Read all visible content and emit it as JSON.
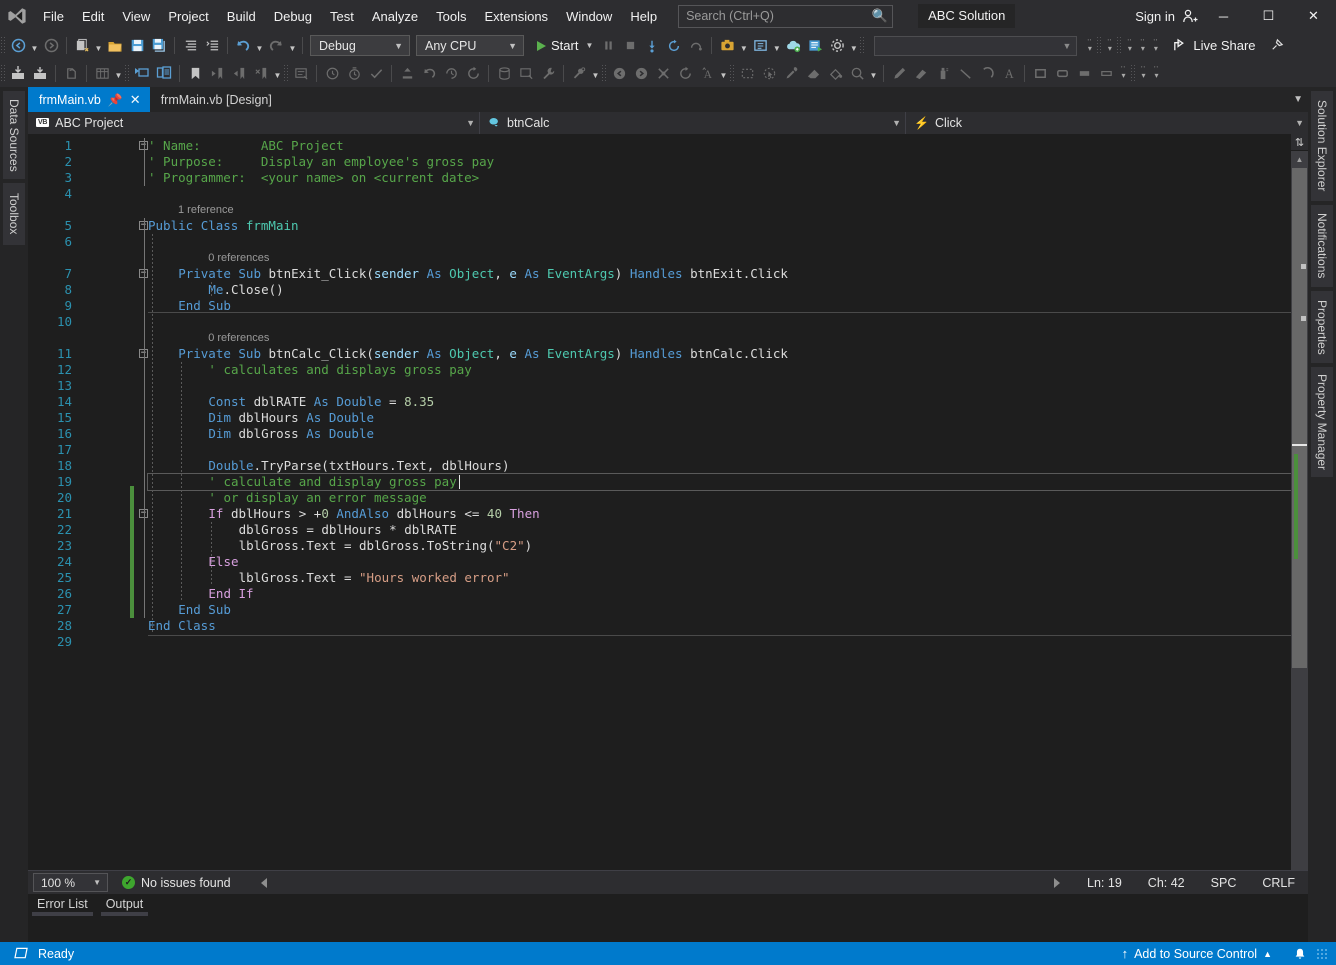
{
  "titlebar": {
    "app_icon": "visual-studio-logo",
    "menus": [
      "File",
      "Edit",
      "View",
      "Project",
      "Build",
      "Debug",
      "Test",
      "Analyze",
      "Tools",
      "Extensions",
      "Window",
      "Help"
    ],
    "search_placeholder": "Search (Ctrl+Q)",
    "search_value": "",
    "search_icon": "search-icon",
    "solution_name": "ABC Solution",
    "signin_label": "Sign in",
    "signin_icon": "account-add-icon",
    "minimize": "─",
    "maximize": "☐",
    "close": "✕"
  },
  "toolbar_main": {
    "back_icon": "navigate-back-icon",
    "forward_icon": "navigate-forward-icon",
    "new_project_icon": "new-project-icon",
    "open_file_icon": "open-file-icon",
    "save_icon": "save-icon",
    "save_all_icon": "save-all-icon",
    "comment_icon": "comment-lines-icon",
    "uncomment_icon": "uncomment-lines-icon",
    "undo_icon": "undo-icon",
    "redo_icon": "redo-icon",
    "config_value": "Debug",
    "platform_value": "Any CPU",
    "start_label": "Start",
    "pause_icon": "pause-icon",
    "stop_icon": "stop-icon",
    "step_into_icon": "step-into-icon",
    "restart_icon": "restart-icon",
    "hot_reload_icon": "hot-reload-icon",
    "screenshot_icon": "screenshot-icon",
    "live_visual_tree_icon": "live-visual-tree-icon",
    "cloud_icon": "cloud-icon",
    "run_to_icon": "run-to-icon",
    "settings_icon": "gear-icon",
    "find_combo_value": "",
    "live_share_label": "Live Share",
    "live_share_icon": "live-share-icon",
    "pin_window_icon": "pin-window-icon"
  },
  "toolbar_secondary": {
    "icons": [
      "import-data-icon",
      "export-data-icon",
      "new-query-icon",
      "data-grid-icon",
      "rename-icon",
      "copy-block-icon",
      "bookmark-icon",
      "prev-bookmark-icon",
      "next-bookmark-icon",
      "clear-bookmark-icon",
      "refresh-grid-icon",
      "add-watch-icon",
      "add-timer-icon",
      "check-icon",
      "deploy-icon",
      "undo2-icon",
      "history-icon",
      "refresh-icon",
      "database-icon",
      "preview-icon",
      "wrench-icon",
      "tool-options-icon",
      "back-circle-icon",
      "forward-circle-icon",
      "delete-x-icon",
      "reload-icon",
      "format-text-icon",
      "select-rect-icon",
      "pointer-icon",
      "circle-select-icon",
      "eyedropper-icon",
      "eraser-icon",
      "fill-icon",
      "magnifier-icon",
      "pencil-icon",
      "brush-icon",
      "spray-icon",
      "line-icon",
      "curve-icon",
      "text-icon",
      "rectangle-icon",
      "rounded-rect-icon",
      "filled-rect-icon",
      "outline-rect-icon"
    ]
  },
  "dock_left": {
    "tabs": [
      "Data Sources",
      "Toolbox"
    ]
  },
  "dock_right": {
    "tabs": [
      "Solution Explorer",
      "Notifications",
      "Properties",
      "Property Manager"
    ]
  },
  "editor": {
    "tabs": [
      {
        "label": "frmMain.vb",
        "active": true,
        "pin_icon": "pin-icon",
        "close_icon": "close-icon"
      },
      {
        "label": "frmMain.vb [Design]",
        "active": false
      }
    ],
    "navbar": {
      "project_icon": "vb-project-icon",
      "project_badge": "VB",
      "project": "ABC Project",
      "member_icon": "control-object-icon",
      "member": "btnCalc",
      "event_icon": "event-bolt-icon",
      "event": "Click"
    },
    "lines": [
      {
        "n": 1,
        "indent": 0,
        "tokens": [
          {
            "t": "' Name:        ABC Project",
            "c": "c-cmt"
          }
        ]
      },
      {
        "n": 2,
        "indent": 0,
        "tokens": [
          {
            "t": "' Purpose:     Display an employee's gross pay",
            "c": "c-cmt"
          }
        ]
      },
      {
        "n": 3,
        "indent": 0,
        "tokens": [
          {
            "t": "' Programmer:  <your name> on <current date>",
            "c": "c-cmt"
          }
        ]
      },
      {
        "n": 4,
        "indent": 0,
        "tokens": []
      },
      {
        "n": 5,
        "indent": 0,
        "tokens": [
          {
            "t": "Public",
            "c": "c-kw"
          },
          {
            "t": " ",
            "c": "c-plain"
          },
          {
            "t": "Class",
            "c": "c-kw"
          },
          {
            "t": " ",
            "c": "c-plain"
          },
          {
            "t": "frmMain",
            "c": "c-type"
          }
        ]
      },
      {
        "n": 6,
        "indent": 0,
        "tokens": []
      },
      {
        "n": 7,
        "indent": 1,
        "tokens": [
          {
            "t": "Private",
            "c": "c-kw"
          },
          {
            "t": " ",
            "c": "c-plain"
          },
          {
            "t": "Sub",
            "c": "c-kw"
          },
          {
            "t": " ",
            "c": "c-plain"
          },
          {
            "t": "btnExit_Click",
            "c": "c-plain"
          },
          {
            "t": "(",
            "c": "c-plain"
          },
          {
            "t": "sender",
            "c": "c-mod"
          },
          {
            "t": " ",
            "c": "c-plain"
          },
          {
            "t": "As",
            "c": "c-kw"
          },
          {
            "t": " ",
            "c": "c-plain"
          },
          {
            "t": "Object",
            "c": "c-type"
          },
          {
            "t": ", ",
            "c": "c-plain"
          },
          {
            "t": "e",
            "c": "c-mod"
          },
          {
            "t": " ",
            "c": "c-plain"
          },
          {
            "t": "As",
            "c": "c-kw"
          },
          {
            "t": " ",
            "c": "c-plain"
          },
          {
            "t": "EventArgs",
            "c": "c-type"
          },
          {
            "t": ") ",
            "c": "c-plain"
          },
          {
            "t": "Handles",
            "c": "c-kw"
          },
          {
            "t": " ",
            "c": "c-plain"
          },
          {
            "t": "btnExit.Click",
            "c": "c-plain"
          }
        ]
      },
      {
        "n": 8,
        "indent": 2,
        "tokens": [
          {
            "t": "Me",
            "c": "c-kw"
          },
          {
            "t": ".",
            "c": "c-plain"
          },
          {
            "t": "Close",
            "c": "c-plain"
          },
          {
            "t": "()",
            "c": "c-plain"
          }
        ]
      },
      {
        "n": 9,
        "indent": 1,
        "tokens": [
          {
            "t": "End",
            "c": "c-kw"
          },
          {
            "t": " ",
            "c": "c-plain"
          },
          {
            "t": "Sub",
            "c": "c-kw"
          }
        ]
      },
      {
        "n": 10,
        "indent": 0,
        "tokens": []
      },
      {
        "n": 11,
        "indent": 1,
        "tokens": [
          {
            "t": "Private",
            "c": "c-kw"
          },
          {
            "t": " ",
            "c": "c-plain"
          },
          {
            "t": "Sub",
            "c": "c-kw"
          },
          {
            "t": " ",
            "c": "c-plain"
          },
          {
            "t": "btnCalc_Click",
            "c": "c-plain"
          },
          {
            "t": "(",
            "c": "c-plain"
          },
          {
            "t": "sender",
            "c": "c-mod"
          },
          {
            "t": " ",
            "c": "c-plain"
          },
          {
            "t": "As",
            "c": "c-kw"
          },
          {
            "t": " ",
            "c": "c-plain"
          },
          {
            "t": "Object",
            "c": "c-type"
          },
          {
            "t": ", ",
            "c": "c-plain"
          },
          {
            "t": "e",
            "c": "c-mod"
          },
          {
            "t": " ",
            "c": "c-plain"
          },
          {
            "t": "As",
            "c": "c-kw"
          },
          {
            "t": " ",
            "c": "c-plain"
          },
          {
            "t": "EventArgs",
            "c": "c-type"
          },
          {
            "t": ") ",
            "c": "c-plain"
          },
          {
            "t": "Handles",
            "c": "c-kw"
          },
          {
            "t": " ",
            "c": "c-plain"
          },
          {
            "t": "btnCalc.Click",
            "c": "c-plain"
          }
        ]
      },
      {
        "n": 12,
        "indent": 2,
        "tokens": [
          {
            "t": "' calculates and displays gross pay",
            "c": "c-cmt"
          }
        ]
      },
      {
        "n": 13,
        "indent": 0,
        "tokens": []
      },
      {
        "n": 14,
        "indent": 2,
        "tokens": [
          {
            "t": "Const",
            "c": "c-kw"
          },
          {
            "t": " ",
            "c": "c-plain"
          },
          {
            "t": "dblRATE",
            "c": "c-plain"
          },
          {
            "t": " ",
            "c": "c-plain"
          },
          {
            "t": "As",
            "c": "c-kw"
          },
          {
            "t": " ",
            "c": "c-plain"
          },
          {
            "t": "Double",
            "c": "c-kw"
          },
          {
            "t": " = ",
            "c": "c-plain"
          },
          {
            "t": "8.35",
            "c": "c-num"
          }
        ]
      },
      {
        "n": 15,
        "indent": 2,
        "tokens": [
          {
            "t": "Dim",
            "c": "c-kw"
          },
          {
            "t": " ",
            "c": "c-plain"
          },
          {
            "t": "dblHours",
            "c": "c-plain"
          },
          {
            "t": " ",
            "c": "c-plain"
          },
          {
            "t": "As",
            "c": "c-kw"
          },
          {
            "t": " ",
            "c": "c-plain"
          },
          {
            "t": "Double",
            "c": "c-kw"
          }
        ]
      },
      {
        "n": 16,
        "indent": 2,
        "tokens": [
          {
            "t": "Dim",
            "c": "c-kw"
          },
          {
            "t": " ",
            "c": "c-plain"
          },
          {
            "t": "dblGross",
            "c": "c-plain"
          },
          {
            "t": " ",
            "c": "c-plain"
          },
          {
            "t": "As",
            "c": "c-kw"
          },
          {
            "t": " ",
            "c": "c-plain"
          },
          {
            "t": "Double",
            "c": "c-kw"
          }
        ]
      },
      {
        "n": 17,
        "indent": 0,
        "tokens": []
      },
      {
        "n": 18,
        "indent": 2,
        "tokens": [
          {
            "t": "Double",
            "c": "c-kw"
          },
          {
            "t": ".",
            "c": "c-plain"
          },
          {
            "t": "TryParse",
            "c": "c-plain"
          },
          {
            "t": "(",
            "c": "c-plain"
          },
          {
            "t": "txtHours",
            "c": "c-plain"
          },
          {
            "t": ".",
            "c": "c-plain"
          },
          {
            "t": "Text",
            "c": "c-plain"
          },
          {
            "t": ", ",
            "c": "c-plain"
          },
          {
            "t": "dblHours",
            "c": "c-plain"
          },
          {
            "t": ")",
            "c": "c-plain"
          }
        ]
      },
      {
        "n": 19,
        "indent": 2,
        "tokens": [
          {
            "t": "' calculate and display gross pay",
            "c": "c-cmt"
          }
        ],
        "current": true
      },
      {
        "n": 20,
        "indent": 2,
        "tokens": [
          {
            "t": "' or display an error message",
            "c": "c-cmt"
          }
        ]
      },
      {
        "n": 21,
        "indent": 2,
        "tokens": [
          {
            "t": "If",
            "c": "c-kw2"
          },
          {
            "t": " ",
            "c": "c-plain"
          },
          {
            "t": "dblHours",
            "c": "c-plain"
          },
          {
            "t": " > +",
            "c": "c-plain"
          },
          {
            "t": "0",
            "c": "c-num"
          },
          {
            "t": " ",
            "c": "c-plain"
          },
          {
            "t": "AndAlso",
            "c": "c-kw"
          },
          {
            "t": " ",
            "c": "c-plain"
          },
          {
            "t": "dblHours",
            "c": "c-plain"
          },
          {
            "t": " <= ",
            "c": "c-plain"
          },
          {
            "t": "40",
            "c": "c-num"
          },
          {
            "t": " ",
            "c": "c-plain"
          },
          {
            "t": "Then",
            "c": "c-kw2"
          }
        ]
      },
      {
        "n": 22,
        "indent": 3,
        "tokens": [
          {
            "t": "dblGross",
            "c": "c-plain"
          },
          {
            "t": " = ",
            "c": "c-plain"
          },
          {
            "t": "dblHours",
            "c": "c-plain"
          },
          {
            "t": " * ",
            "c": "c-plain"
          },
          {
            "t": "dblRATE",
            "c": "c-plain"
          }
        ]
      },
      {
        "n": 23,
        "indent": 3,
        "tokens": [
          {
            "t": "lblGross",
            "c": "c-plain"
          },
          {
            "t": ".",
            "c": "c-plain"
          },
          {
            "t": "Text",
            "c": "c-plain"
          },
          {
            "t": " = ",
            "c": "c-plain"
          },
          {
            "t": "dblGross",
            "c": "c-plain"
          },
          {
            "t": ".",
            "c": "c-plain"
          },
          {
            "t": "ToString",
            "c": "c-plain"
          },
          {
            "t": "(",
            "c": "c-plain"
          },
          {
            "t": "\"C2\"",
            "c": "c-str"
          },
          {
            "t": ")",
            "c": "c-plain"
          }
        ]
      },
      {
        "n": 24,
        "indent": 2,
        "tokens": [
          {
            "t": "Else",
            "c": "c-kw2"
          }
        ]
      },
      {
        "n": 25,
        "indent": 3,
        "tokens": [
          {
            "t": "lblGross",
            "c": "c-plain"
          },
          {
            "t": ".",
            "c": "c-plain"
          },
          {
            "t": "Text",
            "c": "c-plain"
          },
          {
            "t": " = ",
            "c": "c-plain"
          },
          {
            "t": "\"Hours worked error\"",
            "c": "c-str"
          }
        ]
      },
      {
        "n": 26,
        "indent": 2,
        "tokens": [
          {
            "t": "End",
            "c": "c-kw2"
          },
          {
            "t": " ",
            "c": "c-plain"
          },
          {
            "t": "If",
            "c": "c-kw2"
          }
        ]
      },
      {
        "n": 27,
        "indent": 1,
        "tokens": [
          {
            "t": "End",
            "c": "c-kw"
          },
          {
            "t": " ",
            "c": "c-plain"
          },
          {
            "t": "Sub",
            "c": "c-kw"
          }
        ]
      },
      {
        "n": 28,
        "indent": 0,
        "tokens": [
          {
            "t": "End",
            "c": "c-kw"
          },
          {
            "t": " ",
            "c": "c-plain"
          },
          {
            "t": "Class",
            "c": "c-kw"
          }
        ]
      },
      {
        "n": 29,
        "indent": 0,
        "tokens": []
      }
    ],
    "codelens": [
      {
        "text": "1 reference",
        "line": 5,
        "indent": 0
      },
      {
        "text": "0 references",
        "line": 7,
        "indent": 1
      },
      {
        "text": "0 references",
        "line": 11,
        "indent": 1
      }
    ],
    "footer": {
      "zoom": "100 %",
      "issues_text": "No issues found",
      "issues_icon": "check-circle-icon",
      "line": "Ln: 19",
      "col": "Ch: 42",
      "spaces": "SPC",
      "eol": "CRLF"
    },
    "scrollbar": {
      "split_icon": "split-view-icon",
      "up_icon": "scroll-up-icon"
    }
  },
  "bottom_tabs": [
    "Error List",
    "Output"
  ],
  "statusbar": {
    "ready_icon": "ready-icon",
    "ready_label": "Ready",
    "source_control_icon": "upload-arrow-icon",
    "source_control_label": "Add to Source Control",
    "source_control_caret": "▲",
    "bell_icon": "notification-bell-icon"
  },
  "colors": {
    "accent": "#007acc",
    "chrome": "#2d2d30",
    "editor_bg": "#1e1e1e",
    "comment": "#57a64a",
    "keyword": "#569cd6",
    "type": "#4ec9b0",
    "string": "#d69d85",
    "number": "#b5cea8",
    "linenum": "#2b91af",
    "changebar": "#4b8f3c"
  }
}
